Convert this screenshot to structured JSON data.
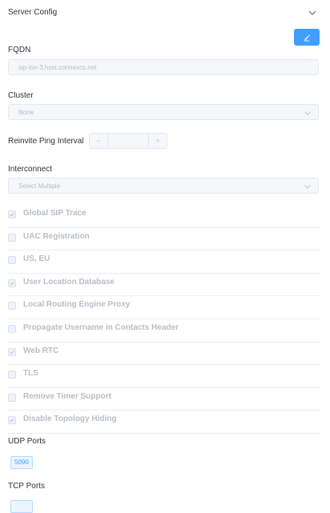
{
  "section": {
    "title": "Server Config"
  },
  "fqdn": {
    "label": "FQDN",
    "value": "sip-lon-3.host.connexcs.net"
  },
  "cluster": {
    "label": "Cluster",
    "value": "None"
  },
  "reinvite": {
    "label": "Reinvite Ping Interval",
    "minus": "−",
    "plus": "+",
    "value": ""
  },
  "interconnect": {
    "label": "Interconnect",
    "placeholder": "Select Multiple"
  },
  "options": [
    {
      "label": "Global SIP Trace",
      "checked": true
    },
    {
      "label": "UAC Registration",
      "checked": false
    },
    {
      "label": "US, EU",
      "checked": false
    },
    {
      "label": "User Location Database",
      "checked": true
    },
    {
      "label": "Local Routing Engine Proxy",
      "checked": false
    },
    {
      "label": "Propagate Username in Contacts Header",
      "checked": false
    },
    {
      "label": "Web RTC",
      "checked": true
    },
    {
      "label": "TLS",
      "checked": false
    },
    {
      "label": "Remove Timer Support",
      "checked": false
    },
    {
      "label": "Disable Topology Hiding",
      "checked": true
    }
  ],
  "udp": {
    "label": "UDP Ports",
    "ports": [
      "5090"
    ]
  },
  "tcp": {
    "label": "TCP Ports"
  },
  "colors": {
    "accent": "#409eff",
    "disabled_text": "#b9bdc5",
    "border": "#e4e7ed"
  }
}
